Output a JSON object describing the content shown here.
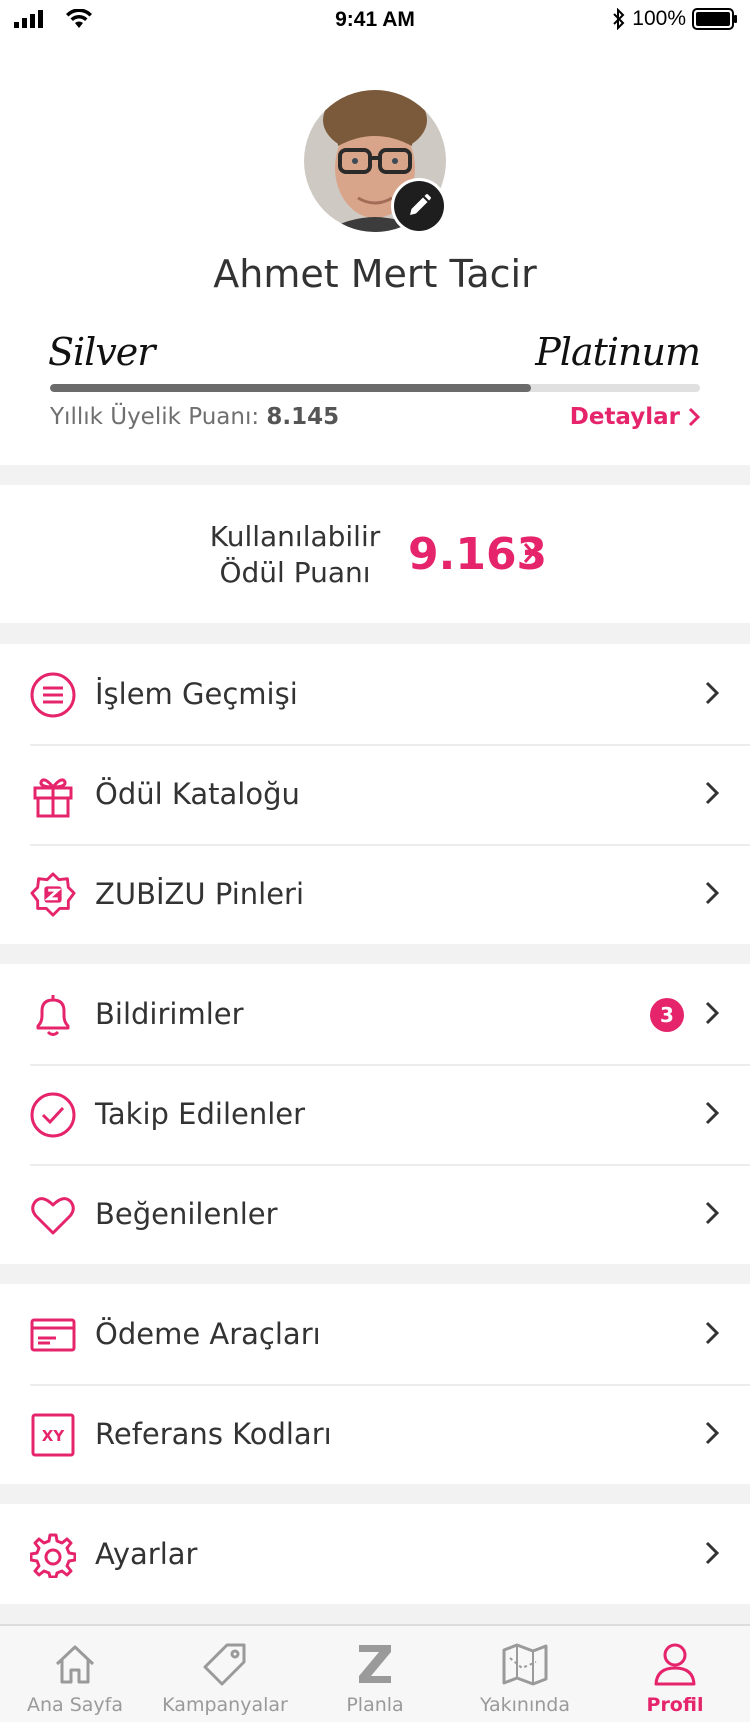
{
  "status_bar": {
    "time": "9:41 AM",
    "battery": "100%"
  },
  "profile": {
    "name": "Ahmet Mert Tacir",
    "tier_current": "Silver",
    "tier_next": "Platinum",
    "progress": 0.74,
    "points_label": "Yıllık Üyelik Puanı:",
    "points_value": "8.145",
    "details_label": "Detaylar"
  },
  "reward": {
    "label_line1": "Kullanılabilir",
    "label_line2": "Ödül Puanı",
    "value": "9.163"
  },
  "menu_groups": [
    [
      {
        "label": "İşlem Geçmişi",
        "icon": "list-icon"
      },
      {
        "label": "Ödül Kataloğu",
        "icon": "gift-icon"
      },
      {
        "label": "ZUBİZU Pinleri",
        "icon": "zubizu-pin-icon"
      }
    ],
    [
      {
        "label": "Bildirimler",
        "icon": "bell-icon",
        "badge": "3"
      },
      {
        "label": "Takip Edilenler",
        "icon": "check-circle-icon"
      },
      {
        "label": "Beğenilenler",
        "icon": "heart-icon"
      }
    ],
    [
      {
        "label": "Ödeme Araçları",
        "icon": "card-icon"
      },
      {
        "label": "Referans Kodları",
        "icon": "xy-code-icon",
        "icon_text": "XY"
      }
    ],
    [
      {
        "label": "Ayarlar",
        "icon": "gear-icon"
      }
    ]
  ],
  "tabbar": {
    "tabs": [
      {
        "label": "Ana Sayfa",
        "icon": "home-icon"
      },
      {
        "label": "Kampanyalar",
        "icon": "tag-icon"
      },
      {
        "label": "Planla",
        "icon": "z-logo-icon"
      },
      {
        "label": "Yakınında",
        "icon": "map-icon"
      },
      {
        "label": "Profil",
        "icon": "user-icon"
      }
    ],
    "active": "Profil"
  },
  "colors": {
    "accent": "#e5246b",
    "text": "#333333",
    "muted": "#9a9a9a"
  }
}
